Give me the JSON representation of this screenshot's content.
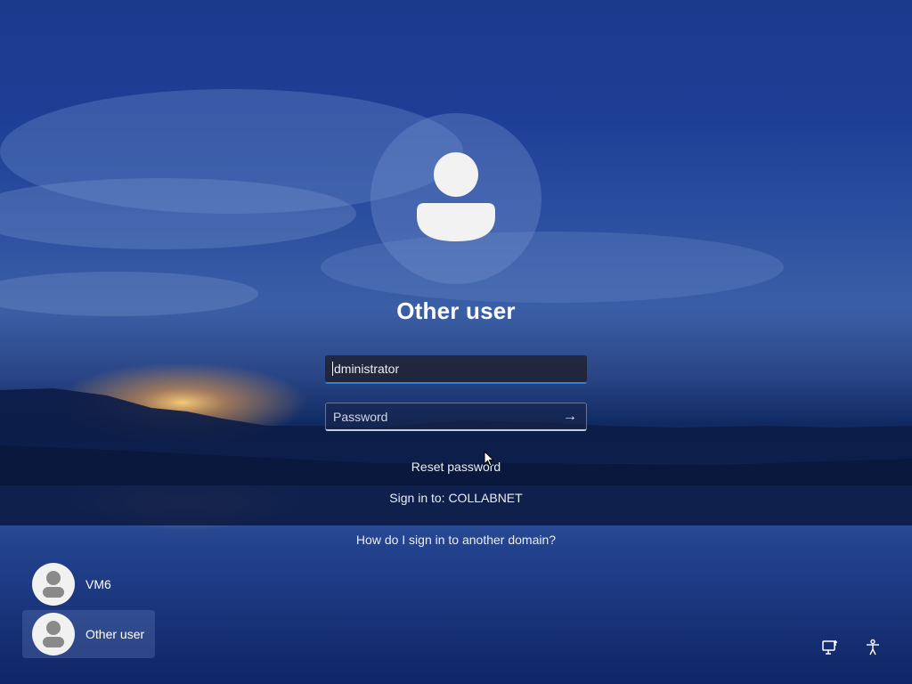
{
  "login": {
    "title": "Other user",
    "username_value": "dministrator",
    "password_placeholder": "Password",
    "reset_password": "Reset password",
    "sign_in_to": "Sign in to: COLLABNET",
    "other_domain": "How do I sign in to another domain?"
  },
  "users": [
    {
      "name": "VM6",
      "selected": false
    },
    {
      "name": "Other user",
      "selected": true
    }
  ],
  "tray": {
    "network_icon": "network-icon",
    "accessibility_icon": "accessibility-icon"
  },
  "colors": {
    "focus_underline": "#3c7fd8",
    "background": "#1e3f96"
  }
}
